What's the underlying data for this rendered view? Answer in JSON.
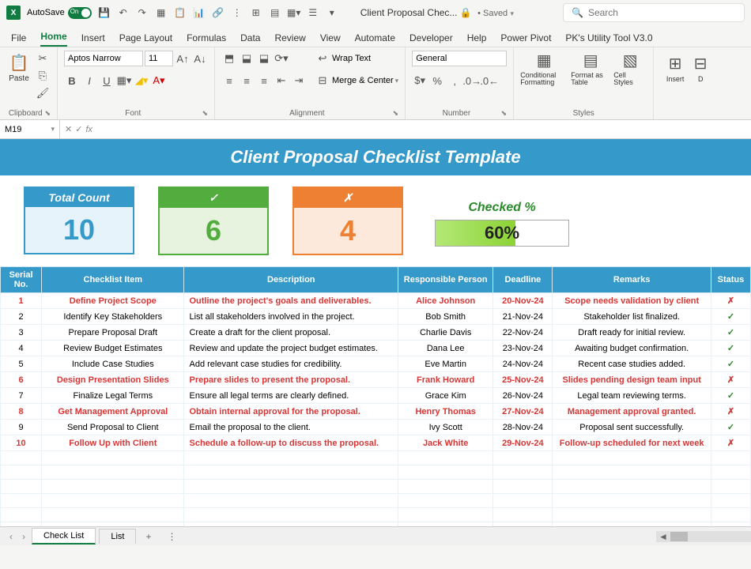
{
  "titlebar": {
    "autosave": "AutoSave",
    "autosave_state": "On",
    "doctitle": "Client Proposal Chec...",
    "saved_indicator": "• Saved",
    "search_placeholder": "Search"
  },
  "ribbon_tabs": [
    "File",
    "Home",
    "Insert",
    "Page Layout",
    "Formulas",
    "Data",
    "Review",
    "View",
    "Automate",
    "Developer",
    "Help",
    "Power Pivot",
    "PK's Utility Tool V3.0"
  ],
  "ribbon": {
    "clipboard": {
      "paste": "Paste",
      "label": "Clipboard"
    },
    "font": {
      "name": "Aptos Narrow",
      "size": "11",
      "bold": "B",
      "italic": "I",
      "underline": "U",
      "label": "Font"
    },
    "alignment": {
      "wrap": "Wrap Text",
      "merge": "Merge & Center",
      "label": "Alignment"
    },
    "number": {
      "format": "General",
      "label": "Number"
    },
    "styles": {
      "conditional": "Conditional Formatting",
      "table": "Format as Table",
      "cell": "Cell Styles",
      "label": "Styles"
    },
    "cells": {
      "insert": "Insert",
      "delete": "D"
    }
  },
  "formula_bar": {
    "cell_ref": "M19",
    "fx": "fx"
  },
  "sheet": {
    "title": "Client Proposal Checklist Template",
    "cards": {
      "total": {
        "label": "Total Count",
        "value": "10"
      },
      "check": {
        "label": "✓",
        "value": "6"
      },
      "fail": {
        "label": "✗",
        "value": "4"
      },
      "progress": {
        "label": "Checked %",
        "value": "60%",
        "percent": 60
      }
    },
    "headers": [
      "Serial No.",
      "Checklist Item",
      "Description",
      "Responsible Person",
      "Deadline",
      "Remarks",
      "Status"
    ],
    "rows": [
      {
        "n": "1",
        "item": "Define Project Scope",
        "desc": "Outline the project's goals and deliverables.",
        "person": "Alice Johnson",
        "deadline": "20-Nov-24",
        "remarks": "Scope needs validation by client",
        "status": "✗",
        "fail": true
      },
      {
        "n": "2",
        "item": "Identify Key Stakeholders",
        "desc": "List all stakeholders involved in the project.",
        "person": "Bob Smith",
        "deadline": "21-Nov-24",
        "remarks": "Stakeholder list finalized.",
        "status": "✓",
        "fail": false
      },
      {
        "n": "3",
        "item": "Prepare Proposal Draft",
        "desc": "Create a draft for the client proposal.",
        "person": "Charlie Davis",
        "deadline": "22-Nov-24",
        "remarks": "Draft ready for initial review.",
        "status": "✓",
        "fail": false
      },
      {
        "n": "4",
        "item": "Review Budget Estimates",
        "desc": "Review and update the project budget estimates.",
        "person": "Dana Lee",
        "deadline": "23-Nov-24",
        "remarks": "Awaiting budget confirmation.",
        "status": "✓",
        "fail": false
      },
      {
        "n": "5",
        "item": "Include Case Studies",
        "desc": "Add relevant case studies for credibility.",
        "person": "Eve Martin",
        "deadline": "24-Nov-24",
        "remarks": "Recent case studies added.",
        "status": "✓",
        "fail": false
      },
      {
        "n": "6",
        "item": "Design Presentation Slides",
        "desc": "Prepare slides to present the proposal.",
        "person": "Frank Howard",
        "deadline": "25-Nov-24",
        "remarks": "Slides pending design team input",
        "status": "✗",
        "fail": true
      },
      {
        "n": "7",
        "item": "Finalize Legal Terms",
        "desc": "Ensure all legal terms are clearly defined.",
        "person": "Grace Kim",
        "deadline": "26-Nov-24",
        "remarks": "Legal team reviewing terms.",
        "status": "✓",
        "fail": false
      },
      {
        "n": "8",
        "item": "Get Management Approval",
        "desc": "Obtain internal approval for the proposal.",
        "person": "Henry Thomas",
        "deadline": "27-Nov-24",
        "remarks": "Management approval granted.",
        "status": "✗",
        "fail": true
      },
      {
        "n": "9",
        "item": "Send Proposal to Client",
        "desc": "Email the proposal to the client.",
        "person": "Ivy Scott",
        "deadline": "28-Nov-24",
        "remarks": "Proposal sent successfully.",
        "status": "✓",
        "fail": false
      },
      {
        "n": "10",
        "item": "Follow Up with Client",
        "desc": "Schedule a follow-up to discuss the proposal.",
        "person": "Jack White",
        "deadline": "29-Nov-24",
        "remarks": "Follow-up scheduled for next week",
        "status": "✗",
        "fail": true
      }
    ]
  },
  "sheet_tabs": {
    "active": "Check List",
    "inactive": "List"
  },
  "chart_data": {
    "type": "table",
    "title": "Client Proposal Checklist Template",
    "summary": {
      "total": 10,
      "checked": 6,
      "unchecked": 4,
      "checked_percent": 60
    }
  }
}
